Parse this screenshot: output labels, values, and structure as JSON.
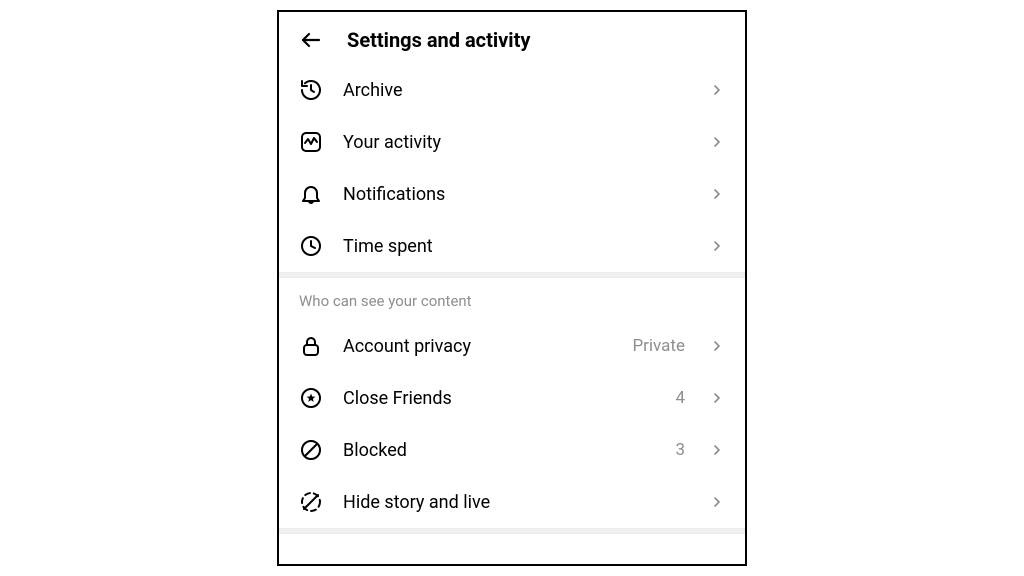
{
  "header": {
    "title": "Settings and activity"
  },
  "section1": {
    "items": [
      {
        "label": "Archive"
      },
      {
        "label": "Your activity"
      },
      {
        "label": "Notifications"
      },
      {
        "label": "Time spent"
      }
    ]
  },
  "section2": {
    "title": "Who can see your content",
    "items": [
      {
        "label": "Account privacy",
        "value": "Private"
      },
      {
        "label": "Close Friends",
        "value": "4"
      },
      {
        "label": "Blocked",
        "value": "3"
      },
      {
        "label": "Hide story and live"
      }
    ]
  }
}
